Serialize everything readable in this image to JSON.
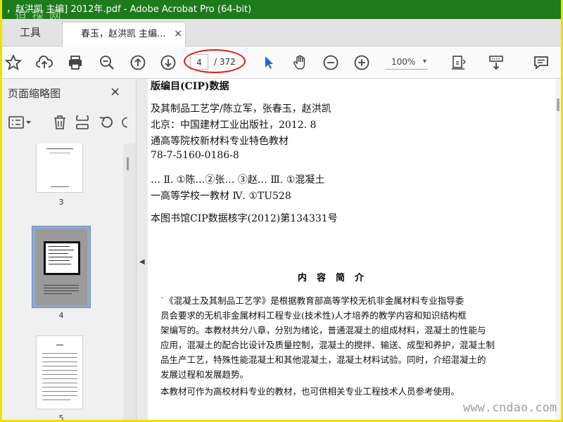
{
  "window": {
    "title": "，赵洪凯 主编] 2012年.pdf - Adobe Acrobat Pro (64-bit)",
    "watermark_top": "迫 探 网"
  },
  "tabs": {
    "tools_label": "工具",
    "document_label": "春玉，赵洪凯 主编...",
    "close_glyph": "×"
  },
  "toolbar": {
    "icons": [
      "star-icon",
      "upload-icon",
      "print-icon",
      "zoom-out-search-icon",
      "page-up-icon",
      "page-down-icon",
      "select-cursor-icon",
      "hand-icon",
      "zoom-out-icon",
      "zoom-in-icon",
      "page-fit-icon",
      "scroll-mode-icon",
      "comment-icon"
    ],
    "page_current": "4",
    "page_total": "/ 372",
    "zoom": "100%",
    "zoom_caret": "▾",
    "highlight_color": "#e01818"
  },
  "sidebar": {
    "title": "页面缩略图",
    "close_glyph": "×",
    "thumbnails": [
      {
        "label": "3"
      },
      {
        "label": "4",
        "selected": true
      },
      {
        "label": "5"
      }
    ]
  },
  "document": {
    "lines": [
      "版编目(CIP)数据",
      "及其制品工艺学/陈立军，张春玉，赵洪凯",
      "北京：中国建材工业出版社，2012. 8",
      "通高等院校新材料专业特色教材",
      "78-7-5160-0186-8",
      "…  Ⅱ. ①陈…②张…  ③赵…  Ⅲ. ①混凝土",
      "一高等学校一教材  Ⅳ. ①TU528",
      "本图书馆CIP数据核字(2012)第134331号"
    ],
    "summary_title": "内容简介",
    "paragraph": [
      "`《混凝土及其制品工艺学》是根据教育部高等学校无机非金属材料专业指导委",
      "员会要求的无机非金属材料工程专业(技术性)人才培养的教学内容和知识结构框",
      "架编写的。本教材共分八章，分别为绪论，普通混凝土的组成材料，混凝土的性能与",
      "应用，混凝土的配合比设计及质量控制，混凝土的搅拌、输送、成型和养护，混凝土制",
      "品生产工艺，特殊性能混凝土和其他混凝土，混凝土材料试验。同时，介绍混凝土的",
      "发展过程和发展趋势。",
      "    本教材可作为高校材料专业的教材，也可供相关专业工程技术人员参考使用。"
    ]
  },
  "watermark_bottom": "www.cndao.com",
  "colors": {
    "titlebar": "#1d7a1d",
    "frame": "#f0e000",
    "select_cursor": "#1a66d6"
  }
}
